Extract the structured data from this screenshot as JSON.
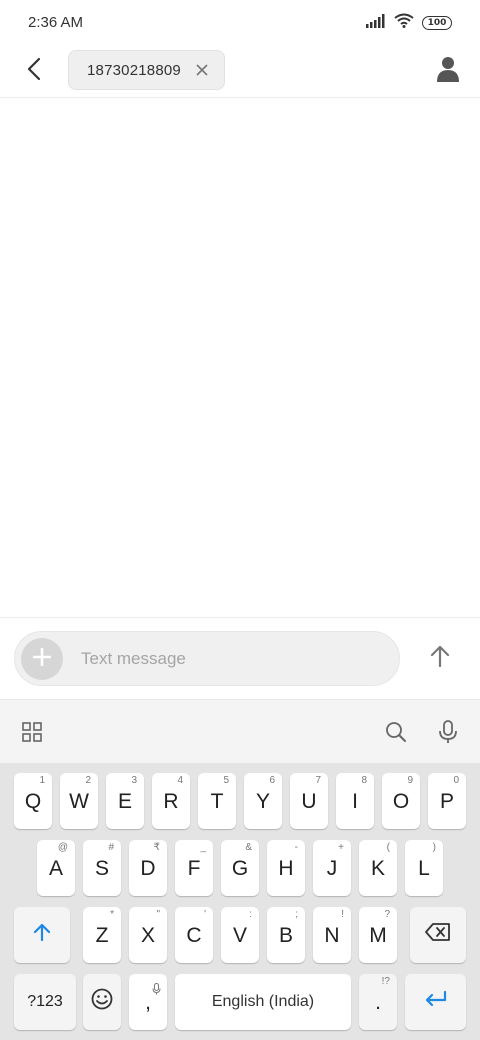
{
  "status_bar": {
    "time": "2:36 AM",
    "battery": "100"
  },
  "header": {
    "recipient": "18730218809"
  },
  "compose": {
    "placeholder": "Text message"
  },
  "keyboard": {
    "row1": [
      {
        "label": "Q",
        "hint": "1"
      },
      {
        "label": "W",
        "hint": "2"
      },
      {
        "label": "E",
        "hint": "3"
      },
      {
        "label": "R",
        "hint": "4"
      },
      {
        "label": "T",
        "hint": "5"
      },
      {
        "label": "Y",
        "hint": "6"
      },
      {
        "label": "U",
        "hint": "7"
      },
      {
        "label": "I",
        "hint": "8"
      },
      {
        "label": "O",
        "hint": "9"
      },
      {
        "label": "P",
        "hint": "0"
      }
    ],
    "row2": [
      {
        "label": "A",
        "hint": "@"
      },
      {
        "label": "S",
        "hint": "#"
      },
      {
        "label": "D",
        "hint": "₹"
      },
      {
        "label": "F",
        "hint": "_"
      },
      {
        "label": "G",
        "hint": "&"
      },
      {
        "label": "H",
        "hint": "-"
      },
      {
        "label": "J",
        "hint": "+"
      },
      {
        "label": "K",
        "hint": "("
      },
      {
        "label": "L",
        "hint": ")"
      }
    ],
    "row3": [
      {
        "label": "Z",
        "hint": "*"
      },
      {
        "label": "X",
        "hint": "\""
      },
      {
        "label": "C",
        "hint": "'"
      },
      {
        "label": "V",
        "hint": ":"
      },
      {
        "label": "B",
        "hint": ";"
      },
      {
        "label": "N",
        "hint": "!"
      },
      {
        "label": "M",
        "hint": "?"
      }
    ],
    "symbols_label": "?123",
    "comma_label": ",",
    "space_label": "English (India)",
    "period_label": ".",
    "period_hint": "!?"
  },
  "icons": {
    "back": "chevron-left-icon",
    "chip_close": "close-icon",
    "contact": "person-icon",
    "attach": "plus-icon",
    "send": "arrow-up-icon",
    "apps": "grid-icon",
    "search": "search-icon",
    "mic": "microphone-icon",
    "shift": "shift-icon",
    "backspace": "backspace-icon",
    "emoji": "emoji-icon",
    "enter": "enter-icon"
  },
  "colors": {
    "accent": "#1e88e5",
    "keyboard_bg": "#e4e4e4",
    "key_bg": "#ffffff"
  }
}
